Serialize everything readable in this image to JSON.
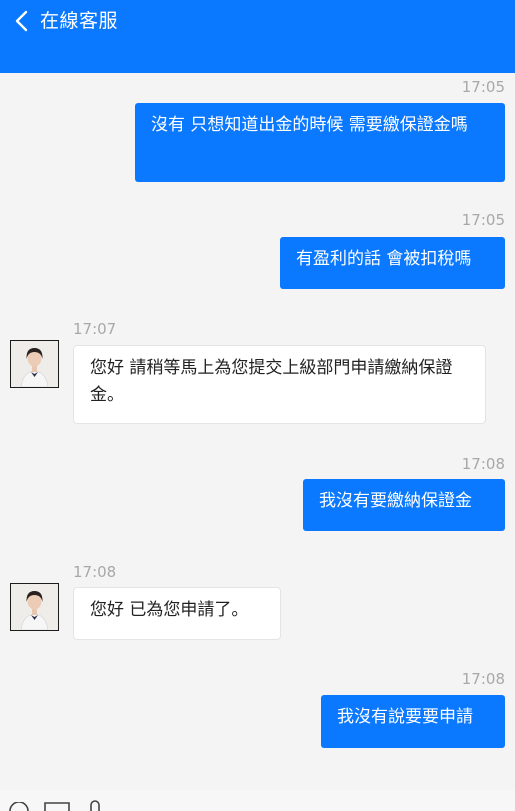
{
  "header": {
    "title": "在線客服",
    "back_icon": "chevron-left-icon",
    "bg_color": "#0a78ff"
  },
  "messages": [
    {
      "time": "17:05",
      "sender": "me",
      "text": "沒有 只想知道出金的時候 需要繳保證金嗎"
    },
    {
      "time": "17:05",
      "sender": "me",
      "text": "有盈利的話 會被扣稅嗎"
    },
    {
      "time": "17:07",
      "sender": "agent",
      "text": "您好 請稍等馬上為您提交上級部門申請繳納保證金。"
    },
    {
      "time": "17:08",
      "sender": "me",
      "text": "我沒有要繳納保證金"
    },
    {
      "time": "17:08",
      "sender": "agent",
      "text": "您好 已為您申請了。"
    },
    {
      "time": "17:08",
      "sender": "me",
      "text": "我沒有說要要申請"
    }
  ],
  "bottom_bar": {
    "icons": [
      "emoji-icon",
      "keyboard-icon",
      "attachment-icon"
    ]
  }
}
